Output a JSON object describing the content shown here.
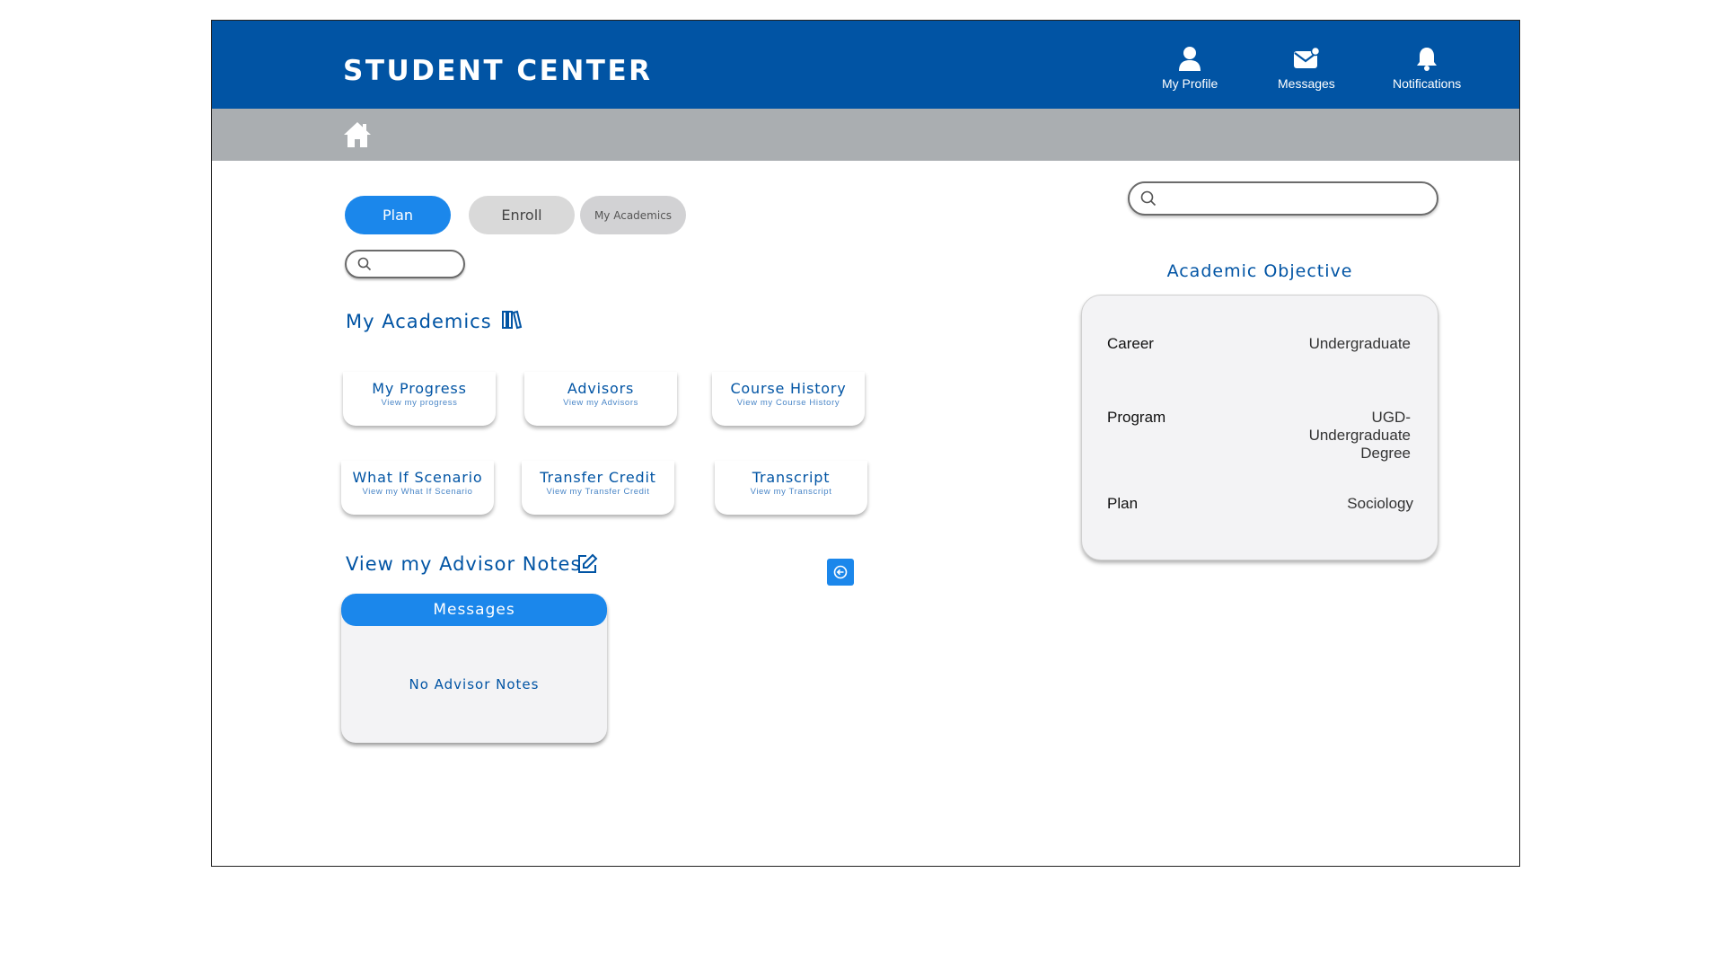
{
  "header": {
    "title": "STUDENT CENTER"
  },
  "nav": [
    {
      "label": "My Profile",
      "icon": "user-icon"
    },
    {
      "label": "Messages",
      "icon": "mail-icon"
    },
    {
      "label": "Notifications",
      "icon": "bell-icon"
    }
  ],
  "subbar": {
    "icon": "home-icon"
  },
  "tabs": {
    "plan": "Plan",
    "enroll": "Enroll",
    "my_academics": "My Academics"
  },
  "search": {
    "small_placeholder": "",
    "large_placeholder": ""
  },
  "academics": {
    "title": "My Academics",
    "cards": [
      {
        "title": "My Progress",
        "subtitle": "View my progress"
      },
      {
        "title": "Advisors",
        "subtitle": "View my Advisors"
      },
      {
        "title": "Course History",
        "subtitle": "View my Course History"
      },
      {
        "title": "What If Scenario",
        "subtitle": "View my What If Scenario"
      },
      {
        "title": "Transfer Credit",
        "subtitle": "View my Transfer Credit"
      },
      {
        "title": "Transcript",
        "subtitle": "View my Transcript"
      }
    ]
  },
  "advisor_notes": {
    "title": "View my Advisor Notes",
    "panel_header": "Messages",
    "empty_text": "No Advisor Notes"
  },
  "objective": {
    "title": "Academic Objective",
    "rows": [
      {
        "label": "Career",
        "value": "Undergraduate"
      },
      {
        "label": "Program",
        "value": "UGD- Undergraduate Degree"
      },
      {
        "label": "Plan",
        "value": "Sociology"
      }
    ]
  },
  "colors": {
    "primary": "#0154a4",
    "accent": "#1b87eb",
    "subbar": "#aaaeb1",
    "panel": "#f3f3f5"
  }
}
